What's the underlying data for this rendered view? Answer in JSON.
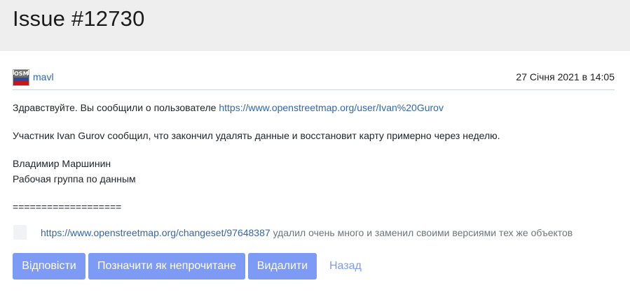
{
  "header": {
    "title": "Issue #12730"
  },
  "comment": {
    "author": "mavl",
    "avatar_text": "OSM",
    "date": "27 Січня 2021 в 14:05",
    "line1_text": "Здравствуйте. Вы сообщили о пользователе",
    "line1_link": "https://www.openstreetmap.org/user/Ivan%20Gurov",
    "line2": "Участник Ivan Gurov сообщил, что закончил удалять данные и восстановит карту примерно через неделю.",
    "signature_name": "Владимир Маршинин",
    "signature_group": "Рабочая группа по данным",
    "separator": "==================="
  },
  "report": {
    "link": "https://www.openstreetmap.org/changeset/97648387",
    "text": "удалил очень много и заменил своими версиями тех же объектов"
  },
  "actions": {
    "reply": "Відповісти",
    "mark_unread": "Позначити як непрочитане",
    "delete": "Видалити",
    "back": "Назад"
  },
  "colors": {
    "header_bg": "#eeeeee",
    "button_bg": "#7d9af5",
    "link": "#3366aa"
  }
}
